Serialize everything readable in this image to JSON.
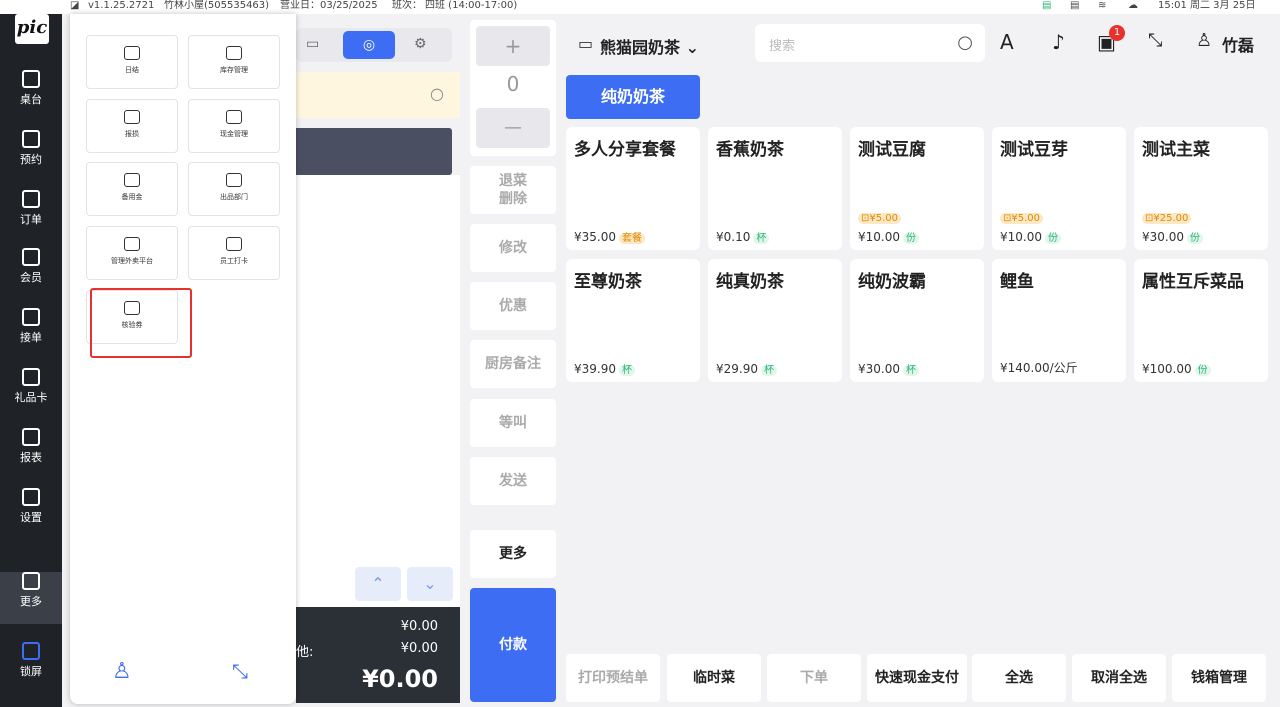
{
  "status_bar": {
    "version": "v1.1.25.2721",
    "store": "竹林小屋(505535463)",
    "business_day": "营业日：03/25/2025",
    "shift": "班次：",
    "shift_name": "四班 (14:00-17:00)",
    "time": "15:01 周二 3月 25日"
  },
  "sidebar": {
    "logo": "pic",
    "items": [
      {
        "label": "桌台",
        "icon": "table-icon"
      },
      {
        "label": "预约",
        "icon": "calendar-icon"
      },
      {
        "label": "订单",
        "icon": "order-icon"
      },
      {
        "label": "会员",
        "icon": "member-icon"
      },
      {
        "label": "接单",
        "icon": "accept-order-icon"
      },
      {
        "label": "礼品卡",
        "icon": "gift-card-icon"
      },
      {
        "label": "报表",
        "icon": "report-icon"
      },
      {
        "label": "设置",
        "icon": "settings-icon"
      },
      {
        "label": "更多",
        "icon": "more-icon"
      },
      {
        "label": "锁屏",
        "icon": "lock-icon"
      }
    ]
  },
  "more_panel": {
    "tiles": [
      {
        "label": "日结",
        "icon": "daily-close-icon"
      },
      {
        "label": "库存管理",
        "icon": "inventory-icon"
      },
      {
        "label": "报损",
        "icon": "report-loss-icon"
      },
      {
        "label": "现金管理",
        "icon": "cash-management-icon"
      },
      {
        "label": "备用金",
        "icon": "reserve-fund-icon"
      },
      {
        "label": "出品部门",
        "icon": "production-dept-icon"
      },
      {
        "label": "管理外卖平台",
        "icon": "delivery-platform-icon"
      },
      {
        "label": "员工打卡",
        "icon": "clock-in-icon"
      },
      {
        "label": "核验券",
        "icon": "voucher-verify-icon"
      }
    ]
  },
  "order_totals": {
    "row1_value": "¥0.00",
    "row2_label": "他:",
    "row2_value": "¥0.00",
    "total": "¥0.00"
  },
  "actions": {
    "qty": "0",
    "plus": "+",
    "minus": "—",
    "buttons": [
      "退菜\n删除",
      "修改",
      "优惠",
      "厨房备注",
      "等叫",
      "发送"
    ],
    "more": "更多",
    "pay": "付款"
  },
  "header": {
    "store_name": "熊猫园奶茶",
    "search_placeholder": "搜索",
    "notification_badge": "1",
    "user": "竹磊"
  },
  "category": "纯奶奶茶",
  "products": [
    {
      "name": "多人分享套餐",
      "price": "¥35.00",
      "tag": "套餐",
      "tag_color": "#e08a00",
      "tag_bg": "#fde8c6",
      "discount": ""
    },
    {
      "name": "香蕉奶茶",
      "price": "¥0.10",
      "tag": "杯",
      "tag_color": "#2bb673",
      "tag_bg": "#e2f6ec",
      "discount": ""
    },
    {
      "name": "测试豆腐",
      "price": "¥10.00",
      "tag": "份",
      "tag_color": "#2bb673",
      "tag_bg": "#e2f6ec",
      "discount": "¥5.00"
    },
    {
      "name": "测试豆芽",
      "price": "¥10.00",
      "tag": "份",
      "tag_color": "#2bb673",
      "tag_bg": "#e2f6ec",
      "discount": "¥5.00"
    },
    {
      "name": "测试主菜",
      "price": "¥30.00",
      "tag": "份",
      "tag_color": "#2bb673",
      "tag_bg": "#e2f6ec",
      "discount": "¥25.00"
    },
    {
      "name": "至尊奶茶",
      "price": "¥39.90",
      "tag": "杯",
      "tag_color": "#2bb673",
      "tag_bg": "#e2f6ec",
      "discount": ""
    },
    {
      "name": "纯真奶茶",
      "price": "¥29.90",
      "tag": "杯",
      "tag_color": "#2bb673",
      "tag_bg": "#e2f6ec",
      "discount": ""
    },
    {
      "name": "纯奶波霸",
      "price": "¥30.00",
      "tag": "杯",
      "tag_color": "#2bb673",
      "tag_bg": "#e2f6ec",
      "discount": ""
    },
    {
      "name": "鲤鱼",
      "price": "¥140.00/公斤",
      "tag": "",
      "tag_color": "",
      "tag_bg": "",
      "discount": ""
    },
    {
      "name": "属性互斥菜品",
      "price": "¥100.00",
      "tag": "份",
      "tag_color": "#2bb673",
      "tag_bg": "#e2f6ec",
      "discount": ""
    }
  ],
  "bottom_bar": [
    "打印预结单",
    "临时菜",
    "下单",
    "快速现金支付",
    "全选",
    "取消全选",
    "钱箱管理"
  ],
  "colors": {
    "accent": "#3d6df2",
    "sidebar": "#1f2226",
    "highlight": "#e8312c"
  }
}
